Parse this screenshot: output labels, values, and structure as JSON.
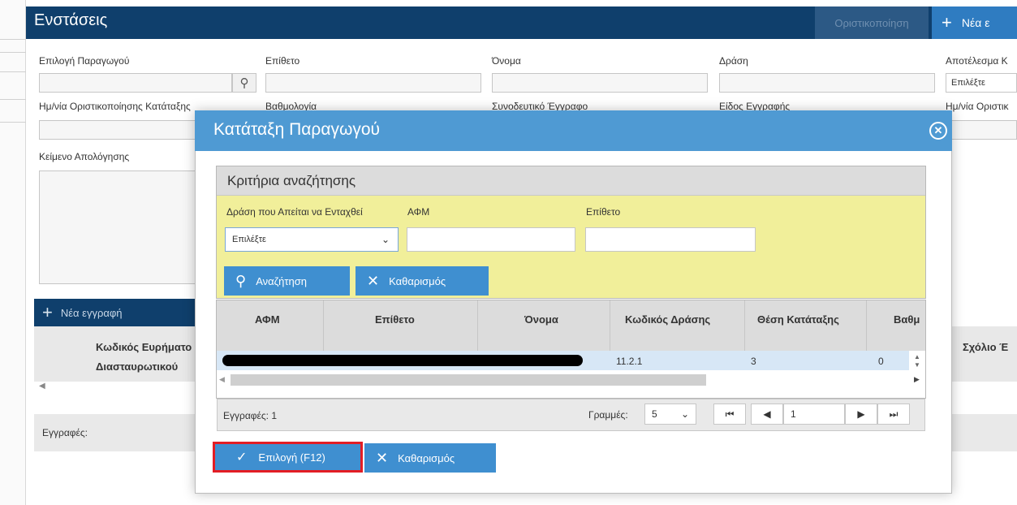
{
  "page": {
    "title": "Ενστάσεις",
    "finalize_label": "Οριστικοποίηση",
    "new_label": "Νέα ε",
    "fields": {
      "producer_label": "Επιλογή Παραγωγού",
      "surname_label": "Επίθετο",
      "name_label": "Όνομα",
      "action_label": "Δράση",
      "result_label": "Αποτέλεσμα Κ",
      "result_value": "Επιλέξτε",
      "date_label": "Ημ/νία Οριστικοποίησης Κατάταξης",
      "score_label": "Βαθμολογία",
      "attached_label": "Συνοδευτικό Έγγραφο",
      "doctype_label": "Είδος Εγγραφής",
      "final_date_label": "Ημ/νία Οριστικ",
      "justification_label": "Κείμενο Απολόγησης"
    },
    "toolbar": {
      "new_record_label": "Νέα εγγραφή"
    },
    "grid": {
      "col1_line1": "Κωδικός Ευρήματο",
      "col1_line2": "Διασταυρωτικού",
      "col_right": "Σχόλιο Έ"
    },
    "records_label": "Εγγραφές:"
  },
  "modal": {
    "title": "Κατάταξη Παραγωγού",
    "criteria": {
      "title": "Κριτήρια αναζήτησης",
      "action_label": "Δράση που Απείται να Ενταχθεί",
      "afm_label": "ΑΦΜ",
      "surname_label": "Επίθετο",
      "action_value": "Επιλέξτε",
      "search_label": "Αναζήτηση",
      "clear_label": "Καθαρισμός"
    },
    "grid": {
      "columns": [
        "ΑΦΜ",
        "Επίθετο",
        "Όνομα",
        "Κωδικός Δράσης",
        "Θέση Κατάταξης",
        "Βαθμ"
      ],
      "row": {
        "code": "11.2.1",
        "position": "3",
        "score": "0"
      },
      "records_label": "Εγγραφές: 1",
      "rows_label": "Γραμμές:",
      "rows_value": "5",
      "page_value": "1"
    },
    "select_label": "Επιλογή (F12)",
    "clear_label": "Καθαρισμός"
  }
}
